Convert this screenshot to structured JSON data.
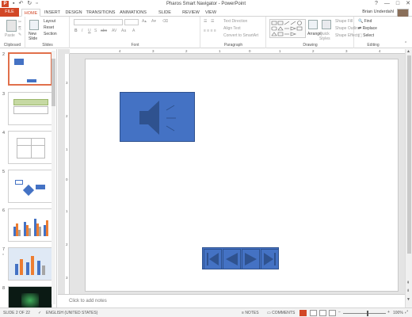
{
  "window": {
    "title": "Pharos Smart Navigator - PowerPoint",
    "app_icon": "P",
    "controls": [
      "?",
      "—",
      "□",
      "✕"
    ]
  },
  "tabs": [
    "FILE",
    "HOME",
    "INSERT",
    "DESIGN",
    "TRANSITIONS",
    "ANIMATIONS",
    "SLIDE SHOW",
    "REVIEW",
    "VIEW"
  ],
  "user": {
    "name": "Brian Underdahl"
  },
  "ribbon": {
    "clipboard": {
      "label": "Clipboard",
      "paste": "Paste"
    },
    "slides": {
      "label": "Slides",
      "new_slide": "New Slide",
      "layout": "Layout",
      "reset": "Reset",
      "section": "Section"
    },
    "font": {
      "label": "Font"
    },
    "paragraph": {
      "label": "Paragraph",
      "text_direction": "Text Direction",
      "align_text": "Align Text",
      "convert_smartart": "Convert to SmartArt"
    },
    "drawing": {
      "label": "Drawing",
      "arrange": "Arrange",
      "quick_styles": "Quick Styles",
      "shape_fill": "Shape Fill",
      "shape_outline": "Shape Outline",
      "shape_effects": "Shape Effects"
    },
    "editing": {
      "label": "Editing",
      "find": "Find",
      "replace": "Replace",
      "select": "Select"
    }
  },
  "thumbnails": [
    {
      "num": "2",
      "star": ""
    },
    {
      "num": "3",
      "star": ""
    },
    {
      "num": "4",
      "star": ""
    },
    {
      "num": "5",
      "star": ""
    },
    {
      "num": "6",
      "star": ""
    },
    {
      "num": "7",
      "star": "*"
    },
    {
      "num": "8",
      "star": ""
    }
  ],
  "ruler": {
    "h": [
      "4",
      "3",
      "2",
      "1",
      "0",
      "1",
      "2",
      "3",
      "4"
    ],
    "v": [
      "3",
      "2",
      "1",
      "0",
      "1",
      "2",
      "3"
    ]
  },
  "notes": {
    "placeholder": "Click to add notes"
  },
  "statusbar": {
    "slide_info": "SLIDE 2 OF 22",
    "language": "ENGLISH (UNITED STATES)",
    "notes": "NOTES",
    "comments": "COMMENTS",
    "zoom_level": "100%"
  },
  "colors": {
    "accent": "#d24726",
    "shape_fill": "#4472c4",
    "shape_border": "#2f528f"
  }
}
